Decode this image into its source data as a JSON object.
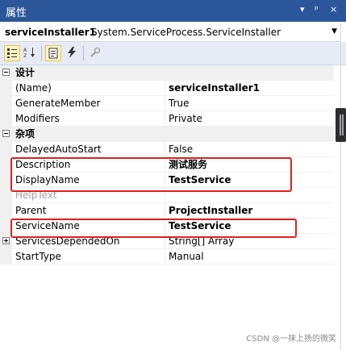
{
  "window": {
    "title": "属性",
    "controls": [
      "▾",
      "ᵖ",
      "×"
    ]
  },
  "object_selector": {
    "name": "serviceInstaller1",
    "type": "System.ServiceProcess.ServiceInstaller",
    "dropdown_icon": "chevron-down-icon"
  },
  "toolbar": {
    "buttons": [
      {
        "name": "categorized-button",
        "icon": "categorized-icon",
        "active": true
      },
      {
        "name": "alphabetical-button",
        "icon": "alphabetical-icon",
        "active": false
      },
      {
        "name": "properties-button",
        "icon": "properties-icon",
        "active": true
      },
      {
        "name": "events-button",
        "icon": "lightning-icon",
        "active": false
      },
      {
        "name": "property-pages-button",
        "icon": "wrench-icon",
        "active": false
      }
    ]
  },
  "grid": {
    "categories": [
      {
        "label": "设计",
        "properties": [
          {
            "name": "(Name)",
            "value": "serviceInstaller1"
          },
          {
            "name": "GenerateMember",
            "value": "True"
          },
          {
            "name": "Modifiers",
            "value": "Private"
          }
        ]
      },
      {
        "label": "杂项",
        "properties": [
          {
            "name": "DelayedAutoStart",
            "value": "False"
          },
          {
            "name": "Description",
            "value": "测试服务"
          },
          {
            "name": "DisplayName",
            "value": "TestService"
          },
          {
            "name": "HelpText",
            "value": ""
          },
          {
            "name": "Parent",
            "value": "ProjectInstaller"
          },
          {
            "name": "ServiceName",
            "value": "TestService"
          },
          {
            "name": "ServicesDependedOn",
            "value": "String[] Array"
          },
          {
            "name": "StartType",
            "value": "Manual"
          }
        ]
      }
    ]
  },
  "colors": {
    "titlebar": "#2b579a",
    "highlight_box": "#e02020",
    "category_background": "#f0f0f0"
  },
  "watermark": "CSDN @一抹上扬的微笑"
}
